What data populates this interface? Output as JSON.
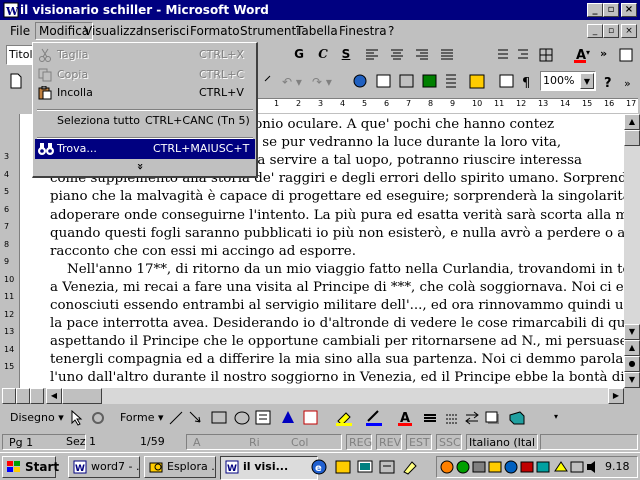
{
  "window": {
    "title": "il visionario schiller - Microsoft Word"
  },
  "menubar": [
    "File",
    "Modifica",
    "Visualizza",
    "Inserisci",
    "Formato",
    "Strumenti",
    "Tabella",
    "Finestra",
    "?"
  ],
  "formatting": {
    "style": "Titolo",
    "zoom": "100%"
  },
  "edit_menu": {
    "items": [
      {
        "label": "Taglia",
        "shortcut": "CTRL+X",
        "enabled": false
      },
      {
        "label": "Copia",
        "shortcut": "CTRL+C",
        "enabled": false
      },
      {
        "label": "Incolla",
        "shortcut": "CTRL+V",
        "enabled": true
      },
      {
        "label": "Seleziona tutto",
        "shortcut": "CTRL+CANC (Tn 5)",
        "enabled": true
      },
      {
        "label": "Trova...",
        "shortcut": "CTRL+MAIUSC+T",
        "enabled": true
      }
    ],
    "more": "»"
  },
  "ruler": {
    "marks": [
      "1",
      "2",
      "3",
      "4",
      "5",
      "6",
      "7",
      "8",
      "9",
      "10",
      "11",
      "12",
      "13",
      "14",
      "15",
      "16",
      "17"
    ]
  },
  "vruler": {
    "marks": [
      "3",
      "4",
      "5",
      "6",
      "7",
      "8",
      "9",
      "10",
      "11",
      "12",
      "13",
      "14",
      "15"
    ]
  },
  "document": {
    "lines": [
      "                              esso testimonio oculare. A que' pochi che hanno contez",
      "                              questi fogli, se pur vedranno la luce durante la loro vita,",
      "                              anche, senza servire a tal uopo, potranno riuscire interessa",
      "come supplemento alla storia de' raggiri e degli errori dello spirito umano. Sorprenderà",
      "piano che la malvagità è capace di progettare ed eseguire; sorprenderà la singolarità de' m",
      "adoperare onde conseguirne l'intento. La più pura ed esatta verità sarà scorta alla mia p",
      "quando questi fogli saranno pubblicati io più non esisterò, e nulla avrò a perdere o a g",
      "racconto che con essi mi accingo ad esporre.",
      "    Nell'anno 17**, di ritorno da un mio viaggio fatto nella Curlandia, trovandomi in temp",
      "a Venezia, mi recai a fare una visita al Principe di ***, che colà soggiornava. Noi ci erava",
      "conosciuti essendo entrambi al servigio militare dell'..., ed ora rinnovammo quindi una co",
      "la pace interrotta avea. Desiderando io d'altronde di vedere le cose rimarcabili di quell",
      "aspettando il Principe che le opportune cambiali per ritornarsene ad N., mi persuase",
      "tenergli compagnia ed a differire la mia sino alla sua partenza. Noi ci demmo parola di",
      "l'uno dall'altro durante il nostro soggiorno in Venezia, ed il Principe ebbe la bontà di of"
    ]
  },
  "drawing": {
    "draw_label": "Disegno",
    "shapes_label": "Forme"
  },
  "statusbar": {
    "page": "Pg 1",
    "section": "Sez 1",
    "pages": "1/59",
    "at": "A",
    "line": "Ri",
    "col": "Col",
    "modes": [
      "REG",
      "REV",
      "EST",
      "SSC"
    ],
    "language": "Italiano (Ital"
  },
  "taskbar": {
    "start": "Start",
    "tasks": [
      "word7 - ...",
      "Esplora ...",
      "il visi..."
    ],
    "clock": "9.18"
  },
  "colors": {
    "titlebar": "#000080",
    "highlight": "#000080",
    "face": "#c0c0c0"
  }
}
